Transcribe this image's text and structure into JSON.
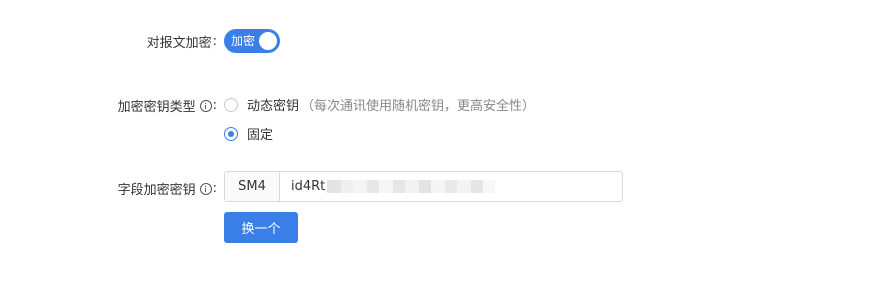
{
  "encrypt_message": {
    "label": "对报文加密",
    "switch_text": "加密",
    "enabled": true
  },
  "key_type": {
    "label": "加密密钥类型",
    "options": [
      {
        "label": "动态密钥",
        "hint": "（每次通讯使用随机密钥，更高安全性）",
        "checked": false
      },
      {
        "label": "固定",
        "hint": "",
        "checked": true
      }
    ]
  },
  "field_key": {
    "label": "字段加密密钥",
    "algorithm": "SM4",
    "value": "id4Rt",
    "masked": true
  },
  "actions": {
    "regenerate_label": "换一个"
  },
  "colors": {
    "primary": "#3a7fe8",
    "hint": "#888888"
  }
}
